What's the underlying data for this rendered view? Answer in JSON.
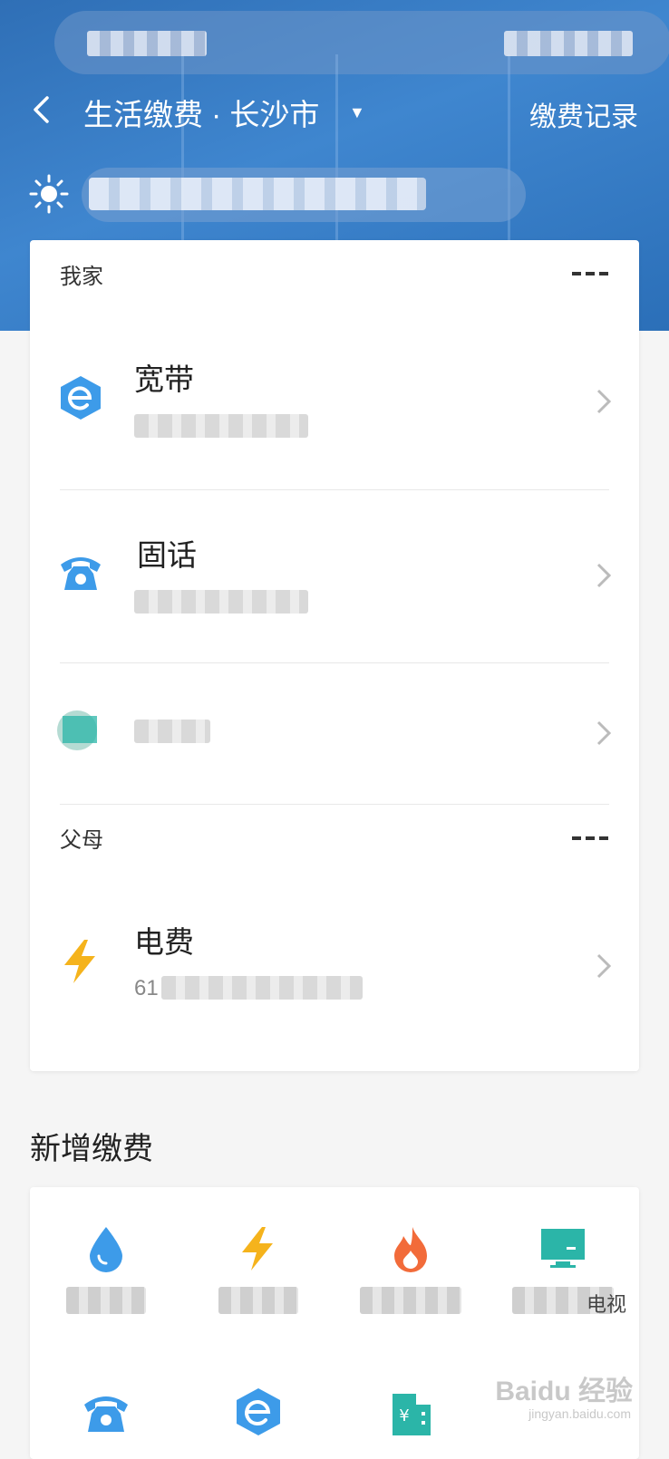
{
  "nav": {
    "title": "生活缴费 · 长沙市",
    "records_label": "缴费记录"
  },
  "groups": [
    {
      "label": "我家",
      "items": [
        {
          "title": "宽带",
          "icon": "broadband-e-icon",
          "color": "#3d9be9"
        },
        {
          "title": "固话",
          "icon": "telephone-icon",
          "color": "#3d9be9"
        },
        {
          "title": "",
          "icon": "tv-icon",
          "color": "#2bb5a8"
        }
      ]
    },
    {
      "label": "父母",
      "items": [
        {
          "title": "电费",
          "subtitle_prefix": "61",
          "icon": "lightning-icon",
          "color": "#f5b31c"
        }
      ]
    }
  ],
  "new_payments": {
    "title": "新增缴费",
    "tiles": [
      {
        "icon": "water-drop-icon",
        "color": "#3d9be9"
      },
      {
        "icon": "lightning-icon",
        "color": "#f5b31c"
      },
      {
        "icon": "flame-icon",
        "color": "#f26b3a"
      },
      {
        "icon": "tv-icon",
        "color": "#2bb5a8",
        "label_suffix": "电视"
      },
      {
        "icon": "telephone-icon",
        "color": "#3d9be9"
      },
      {
        "icon": "broadband-e-icon",
        "color": "#3d9be9"
      },
      {
        "icon": "building-fee-icon",
        "color": "#2bb5a8"
      }
    ]
  },
  "watermark": {
    "text": "Baidu 经验",
    "sub": "jingyan.baidu.com"
  },
  "colors": {
    "header_blue": "#3f86cf",
    "accent_blue": "#3d9be9"
  }
}
